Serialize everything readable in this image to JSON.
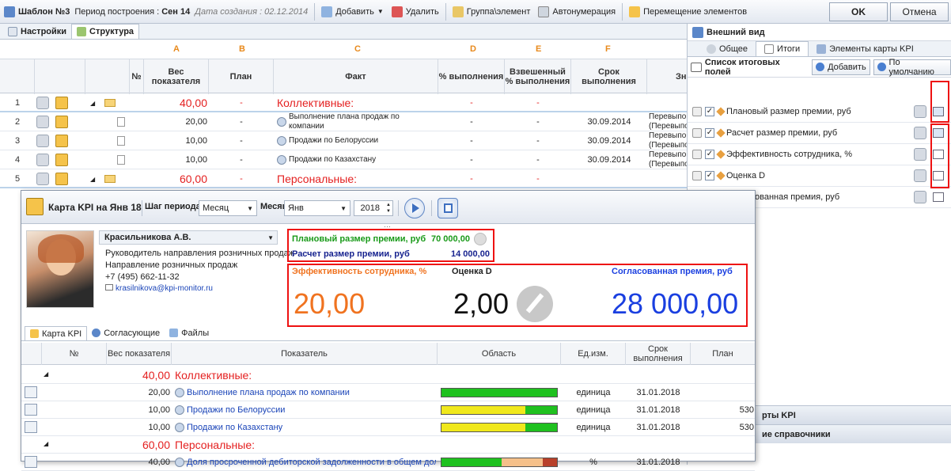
{
  "toolbar": {
    "title": "Шаблон №3",
    "period_label": "Период построения :",
    "period_value": "Сен 14",
    "created_label": "Дата создания :",
    "created_value": "02.12.2014",
    "add": "Добавить",
    "delete": "Удалить",
    "group_element": "Группа\\элемент",
    "autonumber": "Автонумерация",
    "move_elements": "Перемещение элементов",
    "ok": "OK",
    "cancel": "Отмена"
  },
  "tabs": [
    "Настройки",
    "Структура"
  ],
  "grid": {
    "letters": [
      "A",
      "B",
      "C",
      "D",
      "E",
      "F"
    ],
    "headers": {
      "num": "№",
      "weight": "Вес показателя",
      "plan": "План",
      "fact": "Факт",
      "pct": "% выполнения",
      "weighted": "Взвешенный % выполнения",
      "deadline": "Срок выполнения",
      "extra": "Зн"
    },
    "rows": [
      {
        "n": "1",
        "group": true,
        "weight": "40,00",
        "plan": "-",
        "fact": "Коллективные:",
        "pct": "-",
        "weighted": "-",
        "deadline": "",
        "extra": ""
      },
      {
        "n": "2",
        "group": false,
        "weight": "20,00",
        "plan": "-",
        "fact": "Выполнение плана продаж по компании",
        "pct": "-",
        "weighted": "-",
        "deadline": "30.09.2014",
        "extra": "Перевыпо (Перевыпо"
      },
      {
        "n": "3",
        "group": false,
        "weight": "10,00",
        "plan": "-",
        "fact": "Продажи по Белоруссии",
        "pct": "-",
        "weighted": "-",
        "deadline": "30.09.2014",
        "extra": "Перевыпо (Перевыпо"
      },
      {
        "n": "4",
        "group": false,
        "weight": "10,00",
        "plan": "-",
        "fact": "Продажи по Казахстану",
        "pct": "-",
        "weighted": "-",
        "deadline": "30.09.2014",
        "extra": "Перевыпо (Перевыпо"
      },
      {
        "n": "5",
        "group": true,
        "weight": "60,00",
        "plan": "-",
        "fact": "Персональные:",
        "pct": "-",
        "weighted": "-",
        "deadline": "",
        "extra": ""
      }
    ]
  },
  "right_panel": {
    "title": "Внешний вид",
    "tabs": [
      "Общее",
      "Итоги",
      "Элементы карты KPI"
    ],
    "list_title": "Список итоговых полей",
    "add": "Добавить",
    "default": "По умолчанию",
    "items": [
      "Плановый размер премии, руб",
      "Расчет размер премии, руб",
      "Эффективность сотрудника, %",
      "Оценка D",
      "Согласованная премия, руб"
    ],
    "bottom_1": "рты KPI",
    "bottom_2": "ие справочники"
  },
  "popup": {
    "title": "Карта KPI на Янв 18",
    "step_label": "Шаг периода:",
    "step_value": "Месяц",
    "month_label": "Месяц",
    "month_value": "Янв",
    "year_value": "2018",
    "employee": {
      "name": "Красильникова А.В.",
      "position": "Руководитель направления розничных продаж",
      "department": "Направление розничных продаж",
      "phone": "+7 (495) 662-11-32",
      "email": "krasilnikova@kpi-monitor.ru"
    },
    "summary": {
      "plan_label": "Плановый размер премии, руб",
      "plan_value": "70 000,00",
      "calc_label": "Расчет размер премии, руб",
      "calc_value": "14 000,00",
      "eff_label": "Эффективность сотрудника, %",
      "eff_value": "20,00",
      "score_label": "Оценка D",
      "score_value": "2,00",
      "agreed_label": "Согласованная премия, руб",
      "agreed_value": "28 000,00"
    },
    "tabs": [
      "Карта KPI",
      "Согласующие",
      "Файлы"
    ],
    "headers": {
      "num": "№",
      "weight": "Вес показателя",
      "indicator": "Показатель",
      "area": "Область",
      "unit": "Ед.изм.",
      "deadline": "Срок выполнения",
      "plan": "План"
    },
    "rows": [
      {
        "group": true,
        "weight": "40,00",
        "name": "Коллективные:",
        "unit": "",
        "deadline": "",
        "plan": ""
      },
      {
        "group": false,
        "weight": "20,00",
        "name": "Выполнение плана продаж по компании",
        "unit": "единица",
        "deadline": "31.01.2018",
        "plan": ""
      },
      {
        "group": false,
        "weight": "10,00",
        "name": "Продажи по Белоруссии",
        "unit": "единица",
        "deadline": "31.01.2018",
        "plan": "530"
      },
      {
        "group": false,
        "weight": "10,00",
        "name": "Продажи по Казахстану",
        "unit": "единица",
        "deadline": "31.01.2018",
        "plan": "530"
      },
      {
        "group": true,
        "weight": "60,00",
        "name": "Персональные:",
        "unit": "",
        "deadline": "",
        "plan": ""
      },
      {
        "group": false,
        "weight": "40,00",
        "name": "Доля просроченной дебиторской задолженности в общем долге",
        "unit": "%",
        "deadline": "31.01.2018",
        "plan": ""
      }
    ],
    "colors": {
      "green": "#1fc11f",
      "yellow": "#f0e81c",
      "peach": "#f5c08a",
      "brown": "#b8402a",
      "orange": "#f07320",
      "blue": "#1a3fe0"
    }
  }
}
